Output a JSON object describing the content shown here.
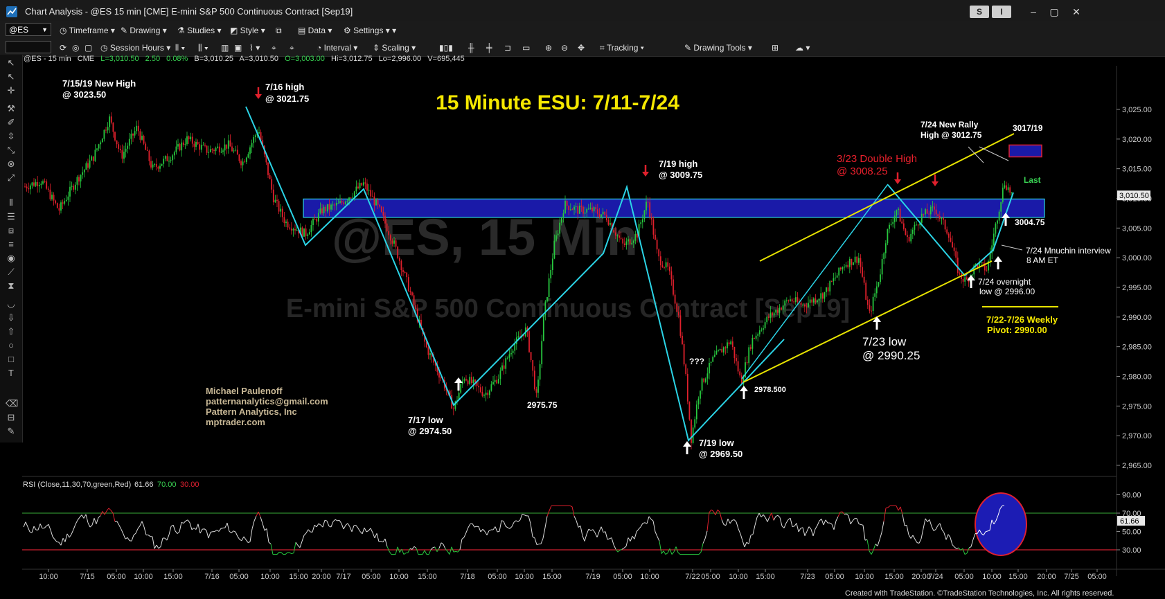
{
  "window": {
    "title": "Chart Analysis - @ES 15 min [CME] E-mini S&P 500 Continuous Contract [Sep19]",
    "buttons": [
      "S",
      "I"
    ]
  },
  "toolbar1": {
    "symbol": "@ES",
    "items": [
      "Timeframe",
      "Drawing",
      "Studies",
      "Style",
      "Data",
      "Settings"
    ]
  },
  "toolbar2": {
    "items": [
      "Session Hours",
      "Interval",
      "Scaling",
      "Tracking",
      "Drawing Tools"
    ]
  },
  "status": {
    "symbol": "@ES - 15 min",
    "exchange": "CME",
    "last": "L=3,010.50",
    "chg": "2.50",
    "pct": "0.08%",
    "bid": "B=3,010.25",
    "ask": "A=3,010.50",
    "open": "O=3,003.00",
    "high": "Hi=3,012.75",
    "low": "Lo=2,996.00",
    "vol": "V=695,445"
  },
  "chart": {
    "headline": "15 Minute ESU: 7/11-7/24",
    "watermark_big": "@ES, 15 Min",
    "watermark_small": "E-mini S&P 500 Continuous Contract [Sep19]",
    "last_label": "Last",
    "last_price": "3,010.50",
    "price_ticks": [
      "3,025.00",
      "3,020.00",
      "3,015.00",
      "3,010.00",
      "3,005.00",
      "3,000.00",
      "2,995.00",
      "2,990.00",
      "2,985.00",
      "2,980.00",
      "2,975.00",
      "2,970.00",
      "2,965.00"
    ],
    "rsi_ticks": [
      "90.00",
      "70.00",
      "50.00",
      "61.66",
      "30.00"
    ],
    "time_ticks": [
      "10:00",
      "7/15",
      "05:00",
      "10:00",
      "15:00",
      "7/16",
      "05:00",
      "10:00",
      "15:00",
      "20:00",
      "7/17",
      "05:00",
      "10:00",
      "15:00",
      "7/18",
      "05:00",
      "10:00",
      "15:00",
      "7/19",
      "05:00",
      "10:00",
      "7/22",
      "05:00",
      "10:00",
      "15:00",
      "7/23",
      "05:00",
      "10:00",
      "15:00",
      "20:00",
      "7/24",
      "05:00",
      "10:00",
      "15:00",
      "20:00",
      "7/25",
      "05:00"
    ],
    "rsi_label": "RSI (Close,11,30,70,green,Red)",
    "rsi_value": "61.66",
    "rsi_ob": "70.00",
    "rsi_os": "30.00",
    "credit": [
      "Michael Paulenoff",
      "patternanalytics@gmail.com",
      "Pattern Analytics, Inc",
      "mptrader.com"
    ],
    "annotations": {
      "a1": [
        "7/15/19 New High",
        "@ 3023.50"
      ],
      "a2": [
        "7/16 high",
        "@ 3021.75"
      ],
      "a3": [
        "7/19 high",
        "@ 3009.75"
      ],
      "a4": [
        "3/23 Double High",
        "@ 3008.25"
      ],
      "a5": [
        "7/24 New Rally",
        "High @ 3012.75"
      ],
      "a6": "3017/19",
      "a7": "3004.75",
      "a8": [
        "7/24 Mnuchin interview",
        "8 AM ET"
      ],
      "a9": [
        "7/24 overnight",
        "low @ 2996.00"
      ],
      "a10": [
        "7/22-7/26 Weekly",
        "Pivot: 2990.00"
      ],
      "a11": [
        "7/23 low",
        "@ 2990.25"
      ],
      "a12": "2978.500",
      "a13": [
        "7/19 low",
        "@ 2969.50"
      ],
      "a14": [
        "7/17 low",
        "@ 2974.50"
      ],
      "a15": "2975.75",
      "a16": "???"
    }
  },
  "chart_data": {
    "type": "line",
    "title": "15 Minute ESU: 7/11-7/24",
    "ylim": [
      2962,
      3028
    ],
    "key_points": [
      {
        "label": "7/15/19 New High",
        "y": 3023.5
      },
      {
        "label": "7/16 high",
        "y": 3021.75
      },
      {
        "label": "7/17 low",
        "y": 2974.5
      },
      {
        "label": "2975.75",
        "y": 2975.75
      },
      {
        "label": "7/19 high",
        "y": 3009.75
      },
      {
        "label": "7/19 low",
        "y": 2969.5
      },
      {
        "label": "2978.500",
        "y": 2978.5
      },
      {
        "label": "7/23 low",
        "y": 2990.25
      },
      {
        "label": "3/23 Double High",
        "y": 3008.25
      },
      {
        "label": "7/24 overnight low",
        "y": 2996.0
      },
      {
        "label": "3004.75",
        "y": 3004.75
      },
      {
        "label": "7/24 New Rally High",
        "y": 3012.75
      },
      {
        "label": "Last",
        "y": 3010.5
      }
    ],
    "resistance_zone": [
      3006.8,
      3009.9
    ],
    "target_zone": [
      3017,
      3019
    ],
    "weekly_pivot": 2990.0,
    "rsi": {
      "params": "Close,11,30,70",
      "last": 61.66,
      "overbought": 70,
      "oversold": 30
    }
  }
}
